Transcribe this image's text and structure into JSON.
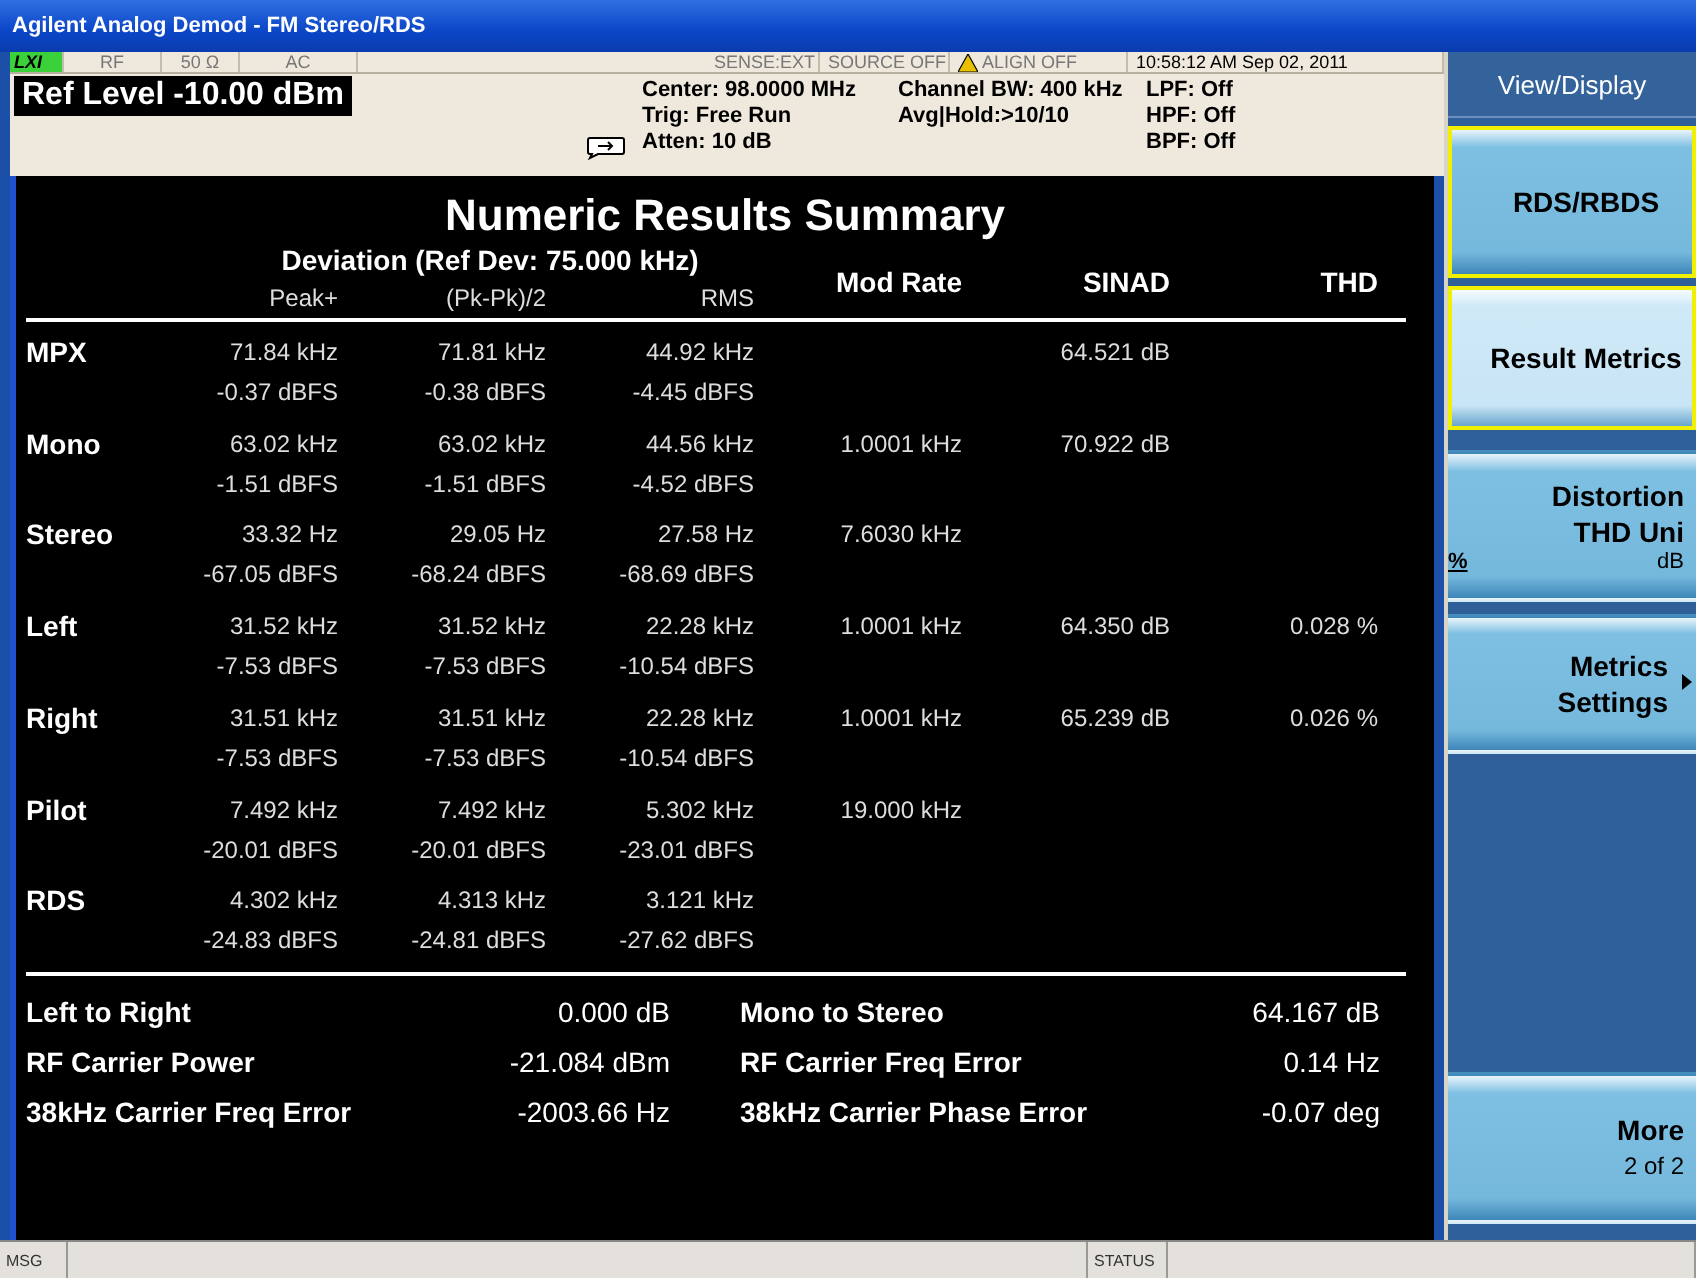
{
  "window": {
    "title": "Agilent Analog Demod - FM Stereo/RDS"
  },
  "meter": {
    "indicators": [
      {
        "text": "LXI",
        "kind": "logo"
      },
      {
        "text": "RF",
        "kind": "plain"
      },
      {
        "text": "50 Ω",
        "kind": "plain"
      },
      {
        "text": "AC",
        "kind": "plain"
      },
      {
        "text": "SENSE:EXT",
        "kind": "plain"
      },
      {
        "text": "SOURCE OFF",
        "kind": "plain"
      },
      {
        "text": "ALIGN OFF",
        "kind": "warning"
      },
      {
        "text": "10:58:12 AM Sep 02, 2011",
        "kind": "time"
      }
    ],
    "ref_level": "Ref Level -10.00 dBm",
    "settings": [
      [
        "Center: 98.0000 MHz",
        "Trig: Free Run",
        "Atten: 10 dB"
      ],
      [
        "Channel BW: 400 kHz",
        "Avg|Hold:>10/10"
      ],
      [
        "LPF: Off",
        "HPF: Off",
        "BPF: Off"
      ]
    ]
  },
  "results": {
    "title": "Numeric Results Summary",
    "deviation_header": "Deviation (Ref Dev: 75.000 kHz)",
    "sub_headers": [
      "Peak+",
      "(Pk-Pk)/2",
      "RMS"
    ],
    "headers": [
      "Mod Rate",
      "SINAD",
      "THD"
    ],
    "rows": [
      {
        "label": "MPX",
        "peak": [
          "71.84 kHz",
          "-0.37 dBFS"
        ],
        "pkpk": [
          "71.81 kHz",
          "-0.38 dBFS"
        ],
        "rms": [
          "44.92 kHz",
          "-4.45 dBFS"
        ],
        "sinad": "64.521 dB"
      },
      {
        "label": "Mono",
        "peak": [
          "63.02 kHz",
          "-1.51 dBFS"
        ],
        "pkpk": [
          "63.02 kHz",
          "-1.51 dBFS"
        ],
        "rms": [
          "44.56 kHz",
          "-4.52 dBFS"
        ],
        "mod_rate": "1.0001 kHz",
        "sinad": "70.922 dB"
      },
      {
        "label": "Stereo",
        "peak": [
          "33.32 Hz",
          "-67.05 dBFS"
        ],
        "pkpk": [
          "29.05 Hz",
          "-68.24 dBFS"
        ],
        "rms": [
          "27.58 Hz",
          "-68.69 dBFS"
        ],
        "mod_rate": "7.6030 kHz"
      },
      {
        "label": "Left",
        "peak": [
          "31.52 kHz",
          "-7.53 dBFS"
        ],
        "pkpk": [
          "31.52 kHz",
          "-7.53 dBFS"
        ],
        "rms": [
          "22.28 kHz",
          "-10.54 dBFS"
        ],
        "mod_rate": "1.0001 kHz",
        "sinad": "64.350 dB",
        "thd": "0.028 %"
      },
      {
        "label": "Right",
        "peak": [
          "31.51 kHz",
          "-7.53 dBFS"
        ],
        "pkpk": [
          "31.51 kHz",
          "-7.53 dBFS"
        ],
        "rms": [
          "22.28 kHz",
          "-10.54 dBFS"
        ],
        "mod_rate": "1.0001 kHz",
        "sinad": "65.239 dB",
        "thd": "0.026 %"
      },
      {
        "label": "Pilot",
        "peak": [
          "7.492 kHz",
          "-20.01 dBFS"
        ],
        "pkpk": [
          "7.492 kHz",
          "-20.01 dBFS"
        ],
        "rms": [
          "5.302 kHz",
          "-23.01 dBFS"
        ],
        "mod_rate": "19.000 kHz"
      },
      {
        "label": "RDS",
        "peak": [
          "4.302 kHz",
          "-24.83 dBFS"
        ],
        "pkpk": [
          "4.313 kHz",
          "-24.81 dBFS"
        ],
        "rms": [
          "3.121 kHz",
          "-27.62 dBFS"
        ]
      }
    ],
    "summary": [
      {
        "label": "Left to Right",
        "value": "0.000 dB"
      },
      {
        "label": "Mono to Stereo",
        "value": "64.167 dB"
      },
      {
        "label": "RF Carrier Power",
        "value": "-21.084 dBm"
      },
      {
        "label": "RF Carrier Freq Error",
        "value": "0.14 Hz"
      },
      {
        "label": "38kHz Carrier Freq Error",
        "value": "-2003.66 Hz"
      },
      {
        "label": "38kHz Carrier Phase Error",
        "value": "-0.07 deg"
      }
    ]
  },
  "softkeys": {
    "title": "View/Display",
    "keys": [
      {
        "kind": "action",
        "lines": [
          "RDS/RBDS"
        ],
        "selected": false,
        "framed": true
      },
      {
        "kind": "action",
        "lines": [
          "Result Metrics"
        ],
        "selected": true,
        "framed": true
      },
      {
        "kind": "toggle",
        "lines": [
          "Distortion",
          "THD Uni"
        ],
        "options": [
          {
            "text": "%",
            "selected": true
          },
          {
            "text": "dB",
            "selected": false
          }
        ],
        "selected": false,
        "framed": false
      },
      {
        "kind": "submenu",
        "lines": [
          "Metrics",
          "Settings"
        ],
        "selected": false,
        "framed": false
      },
      {
        "kind": "more",
        "lines": [
          "More",
          "2 of 2"
        ],
        "selected": false,
        "framed": false
      }
    ]
  },
  "status_bar": {
    "message_label": "MSG",
    "status_label": "STATUS"
  }
}
